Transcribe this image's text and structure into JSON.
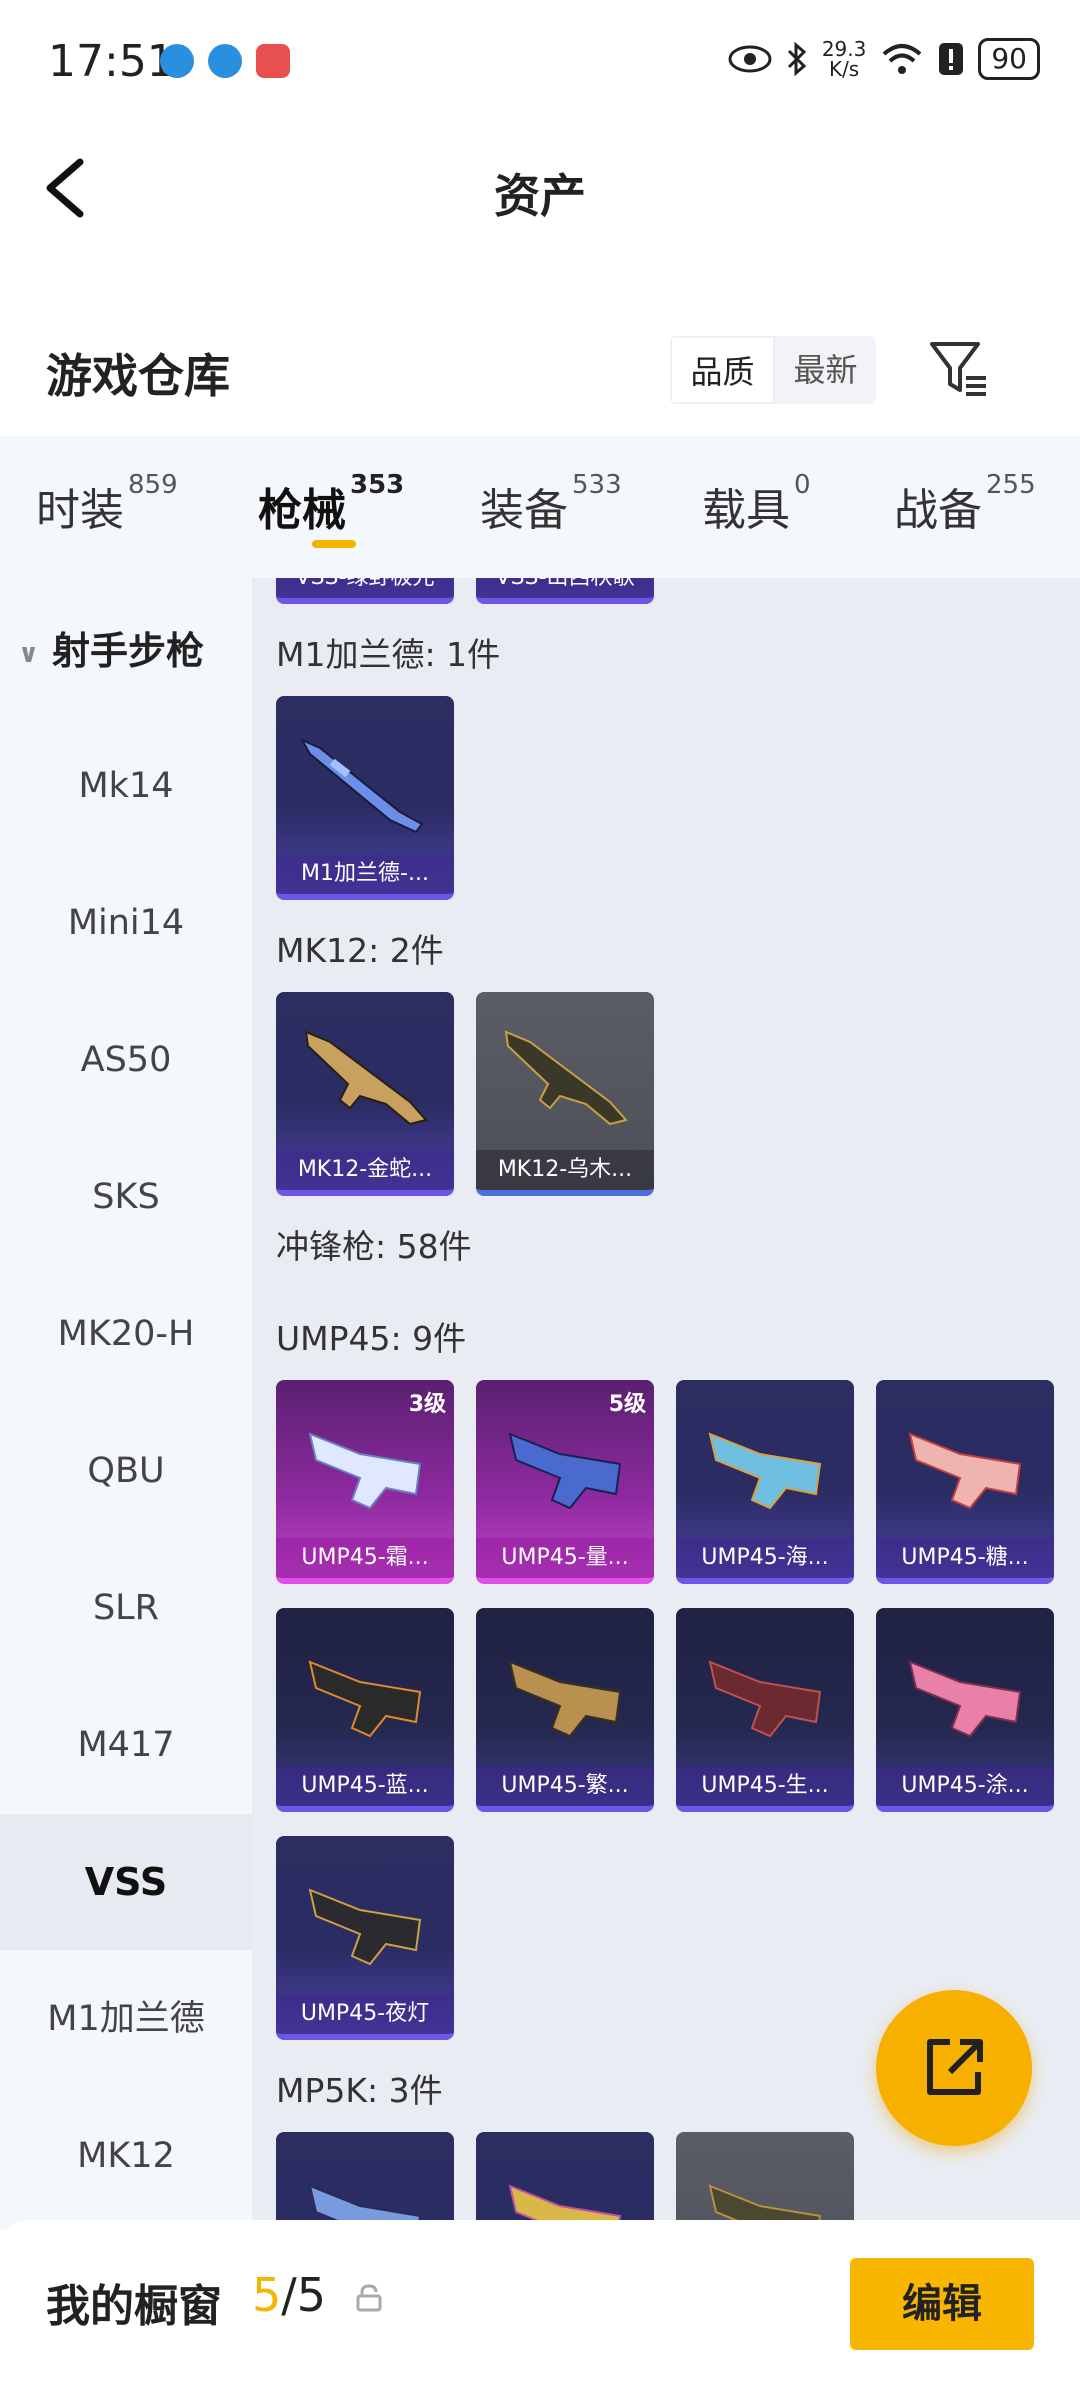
{
  "status": {
    "time": "17:51",
    "speed_value": "29.3",
    "speed_unit": "K/s",
    "battery": "90"
  },
  "header": {
    "title": "资产"
  },
  "warehouse": {
    "title": "游戏仓库",
    "sort_quality": "品质",
    "sort_latest": "最新"
  },
  "tabs": [
    {
      "label": "时装",
      "count": "859"
    },
    {
      "label": "枪械",
      "count": "353"
    },
    {
      "label": "装备",
      "count": "533"
    },
    {
      "label": "载具",
      "count": "0"
    },
    {
      "label": "战备",
      "count": "255"
    }
  ],
  "sidebar": {
    "group": "射手步枪",
    "items": [
      "Mk14",
      "Mini14",
      "AS50",
      "SKS",
      "MK20-H",
      "QBU",
      "SLR",
      "M417",
      "VSS",
      "M1加兰德",
      "MK12"
    ],
    "active": "VSS"
  },
  "main": {
    "top_partial": [
      "VSS-绿野极光",
      "VSS-山西秋歌"
    ],
    "sections": [
      {
        "title": "M1加兰德: 1件",
        "items": [
          {
            "label": "M1加兰德-...",
            "style": "purple"
          }
        ]
      },
      {
        "title": "MK12: 2件",
        "items": [
          {
            "label": "MK12-金蛇...",
            "style": "purple"
          },
          {
            "label": "MK12-乌木...",
            "style": "gray"
          }
        ]
      },
      {
        "title": "冲锋枪: 58件"
      },
      {
        "title": "UMP45: 9件",
        "items": [
          {
            "label": "UMP45-霜...",
            "level": "3级",
            "style": "pink"
          },
          {
            "label": "UMP45-量...",
            "level": "5级",
            "style": "pink"
          },
          {
            "label": "UMP45-海...",
            "style": "purple"
          },
          {
            "label": "UMP45-糖...",
            "style": "purple"
          },
          {
            "label": "UMP45-蓝...",
            "style": "dark"
          },
          {
            "label": "UMP45-繁...",
            "style": "dark"
          },
          {
            "label": "UMP45-生...",
            "style": "dark"
          },
          {
            "label": "UMP45-涂...",
            "style": "dark"
          },
          {
            "label": "UMP45-夜灯",
            "style": "purple"
          }
        ]
      },
      {
        "title": "MP5K: 3件"
      }
    ]
  },
  "bottom": {
    "title": "我的橱窗",
    "count_current": "5",
    "count_total": "/5",
    "edit_label": "编辑"
  },
  "colors": {
    "accent": "#f5b400",
    "sidebar_bg": "#f4f7fb",
    "main_bg": "#e9edf3"
  }
}
